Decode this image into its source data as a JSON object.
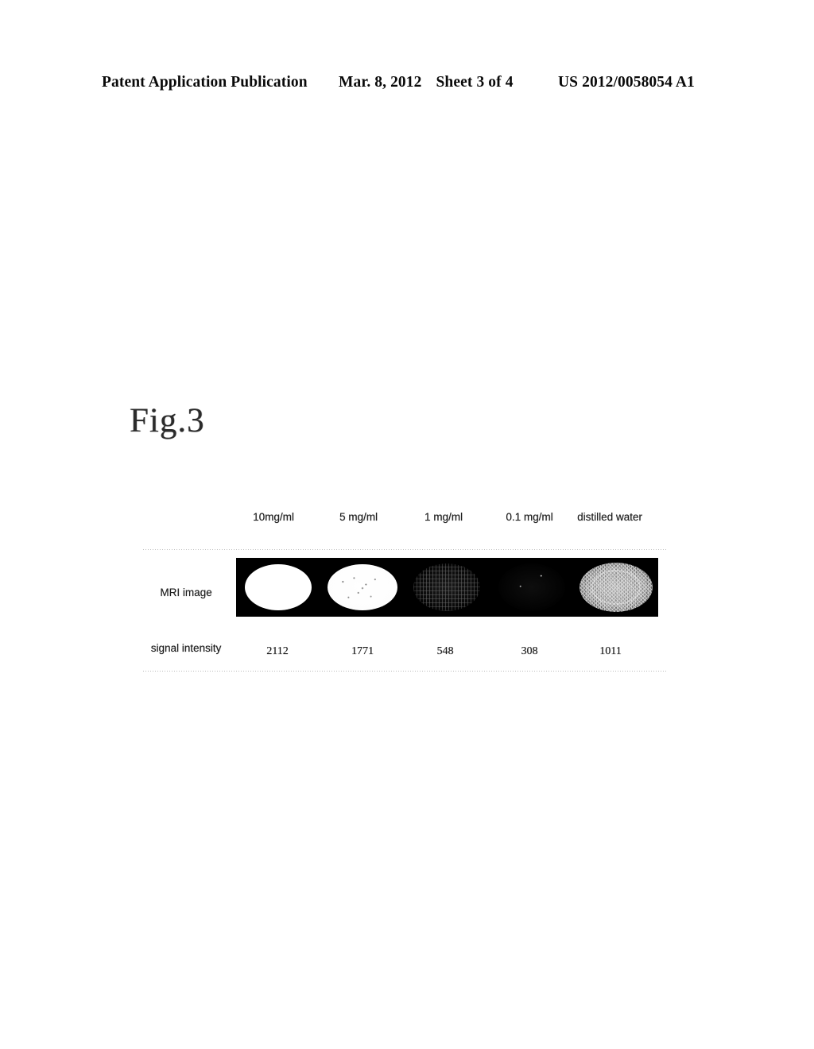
{
  "header": {
    "publication": "Patent Application Publication",
    "date": "Mar. 8, 2012",
    "sheet": "Sheet 3 of 4",
    "patent_number": "US 2012/0058054 A1"
  },
  "figure": {
    "label": "Fig.3",
    "columns": [
      "10mg/ml",
      "5 mg/ml",
      "1 mg/ml",
      "0.1 mg/ml",
      "distilled water"
    ],
    "rows": [
      {
        "label": "MRI image"
      },
      {
        "label": "signal intensity"
      }
    ]
  },
  "chart_data": {
    "type": "table",
    "title": "Fig.3",
    "categories": [
      "10mg/ml",
      "5 mg/ml",
      "1 mg/ml",
      "0.1 mg/ml",
      "distilled water"
    ],
    "row_labels": [
      "MRI image",
      "signal intensity"
    ],
    "series": [
      {
        "name": "signal intensity",
        "values": [
          2112,
          1771,
          548,
          308,
          1011
        ]
      }
    ],
    "mri_appearance": [
      "bright white ellipse",
      "bright white speckled ellipse",
      "faint dithered grey ellipse",
      "no visible ellipse (black)",
      "medium grey dithered ellipse"
    ],
    "xlabel": "",
    "ylabel": "",
    "grid": false,
    "legend": "none"
  }
}
